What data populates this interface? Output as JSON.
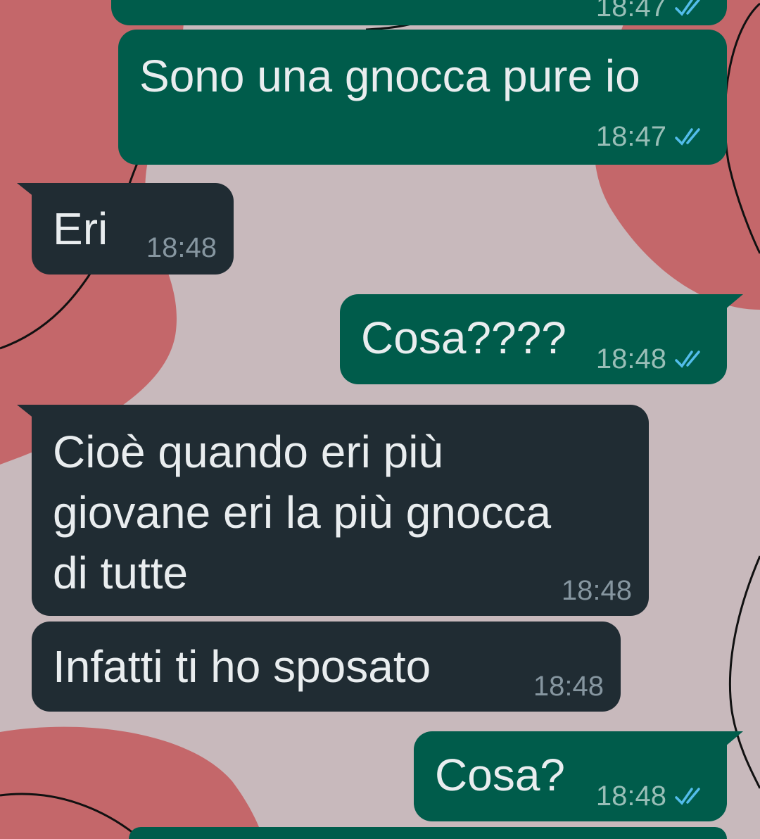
{
  "theme": {
    "outgoing_bubble": "#005c4b",
    "incoming_bubble": "#202c33",
    "text": "#e9edef",
    "read_ticks": "#53bdeb",
    "wallpaper_base": "#c8b9bc",
    "wallpaper_blob": "#c4676a"
  },
  "messages": [
    {
      "direction": "outgoing",
      "text": "",
      "time": "18:47",
      "status": "read",
      "state": "partially-visible-top"
    },
    {
      "direction": "outgoing",
      "text": "Sono una gnocca pure io",
      "time": "18:47",
      "status": "read"
    },
    {
      "direction": "incoming",
      "text": "Eri",
      "time": "18:48"
    },
    {
      "direction": "outgoing",
      "text": "Cosa????",
      "time": "18:48",
      "status": "read"
    },
    {
      "direction": "incoming",
      "text": "Cioè quando eri più\ngiovane eri la più gnocca\ndi tutte",
      "time": "18:48"
    },
    {
      "direction": "incoming",
      "text": "Infatti ti ho sposato",
      "time": "18:48"
    },
    {
      "direction": "outgoing",
      "text": "Cosa?",
      "time": "18:48",
      "status": "read"
    },
    {
      "direction": "outgoing",
      "text": "",
      "state": "partially-visible-bottom"
    }
  ]
}
